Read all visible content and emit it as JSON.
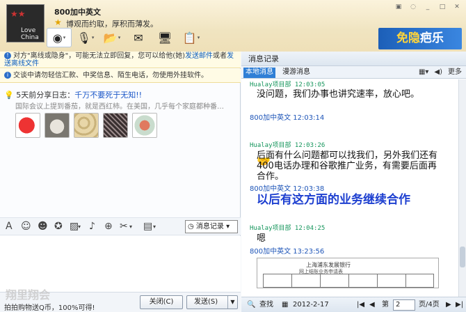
{
  "window": {
    "contact_name": "800加中英文",
    "signature": "博观而约取，厚积而薄发。",
    "avatar_text": "Love China",
    "controls": [
      "▣",
      "◌",
      "_",
      "□",
      "✕"
    ]
  },
  "toolbar": {
    "icons": [
      "video-icon",
      "voice-icon",
      "file-transfer-icon",
      "sms-icon",
      "remote-assist-icon",
      "app-icon"
    ]
  },
  "promo": {
    "prefix": "免隐",
    "text": "疤乐"
  },
  "notices": {
    "notice1_text": "对方\"离线或隐身\"，可能无法立即回复，您可以给他(她)",
    "notice1_link1": "发送邮件",
    "notice1_mid": "或者",
    "notice1_link2": "发送离线文件",
    "notice2_text": "交谈中请勿轻信汇款、中奖信息、陌生电话，勿使用外挂软件。"
  },
  "share": {
    "prefix": "5天前分享日志：",
    "title": "千万不要死于无知!!",
    "summary": "国际会议上提到番茄，就是西红柿。在美国，几乎每个家庭都种番…"
  },
  "input_toolbar": {
    "message_log_label": "消息记录"
  },
  "bottom": {
    "ad_logo": "翔里翔会",
    "ad_text": "拍拍购物送Q币，100%可得!",
    "close_label": "关闭(C)",
    "send_label": "发送(S)"
  },
  "history": {
    "header": "消息记录",
    "tabs": [
      "本地消息",
      "漫游消息"
    ],
    "more_label": "更多",
    "messages": [
      {
        "sender": "Hualay项目部 12:03:05",
        "text": "没问题，我们办事也讲究速率，放心吧。"
      },
      {
        "sender": "800加中英文 12:03:14",
        "text": ""
      },
      {
        "sender": "Hualay项目部 12:03:26",
        "text": "后面有什么问题都可以找我们，另外我们还有400电话办理和谷歌推广业务，有需要后面再合作。"
      },
      {
        "sender": "800加中英文 12:03:38",
        "text": "以后有这方面的业务继续合作"
      },
      {
        "sender": "Hualay项目部 12:04:25",
        "text": "嗯"
      },
      {
        "sender": "800加中英文 13:23:56",
        "text": ""
      }
    ],
    "doc_title": "上海浦东发展银行",
    "doc_subtitle": "网上结账业务申请表",
    "footer": {
      "search_label": "查找",
      "date": "2012-2-17",
      "page_prefix": "第",
      "page_value": "2",
      "page_suffix": "页/4页"
    }
  }
}
